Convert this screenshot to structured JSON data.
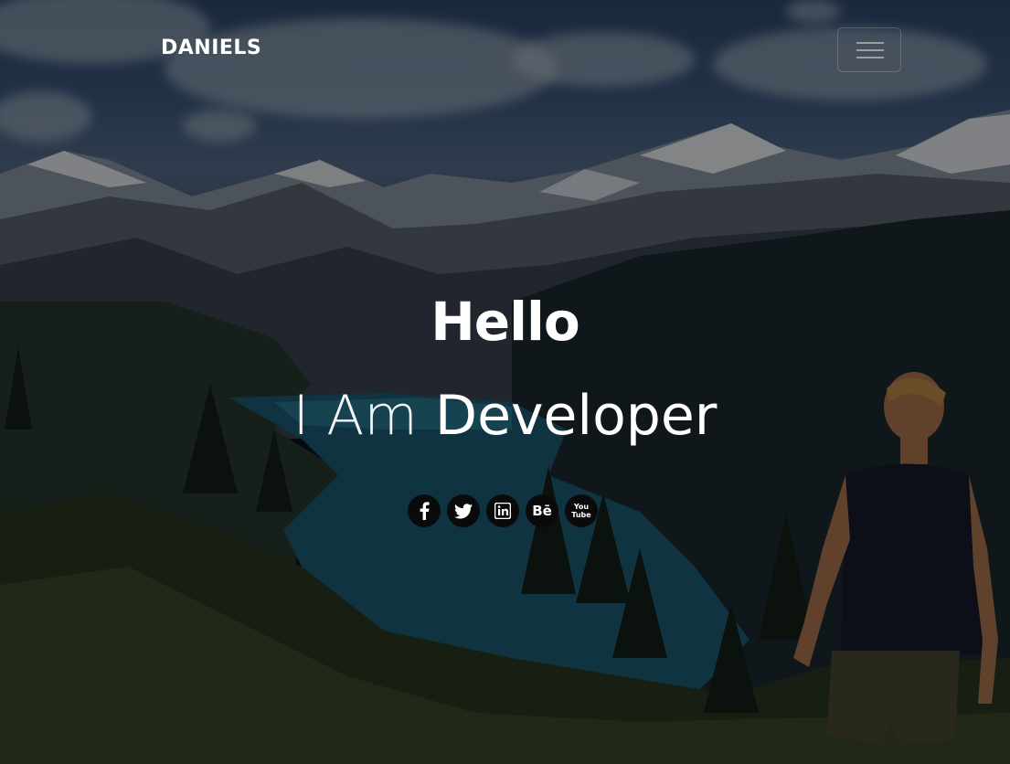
{
  "brand": {
    "name": "DANIELS"
  },
  "nav": {
    "menu_icon": "hamburger-icon"
  },
  "hero": {
    "greeting": "Hello",
    "intro_prefix": "I Am",
    "intro_role": "Developer"
  },
  "socials": [
    {
      "icon": "facebook-icon",
      "label": "f"
    },
    {
      "icon": "twitter-icon",
      "label": ""
    },
    {
      "icon": "linkedin-icon",
      "label": "in"
    },
    {
      "icon": "behance-icon",
      "label": "Bē"
    },
    {
      "icon": "youtube-icon",
      "label": "You Tube"
    }
  ],
  "colors": {
    "text": "#ffffff",
    "social_bg": "#0a0a0a",
    "overlay": "rgba(0,0,0,0.45)"
  }
}
